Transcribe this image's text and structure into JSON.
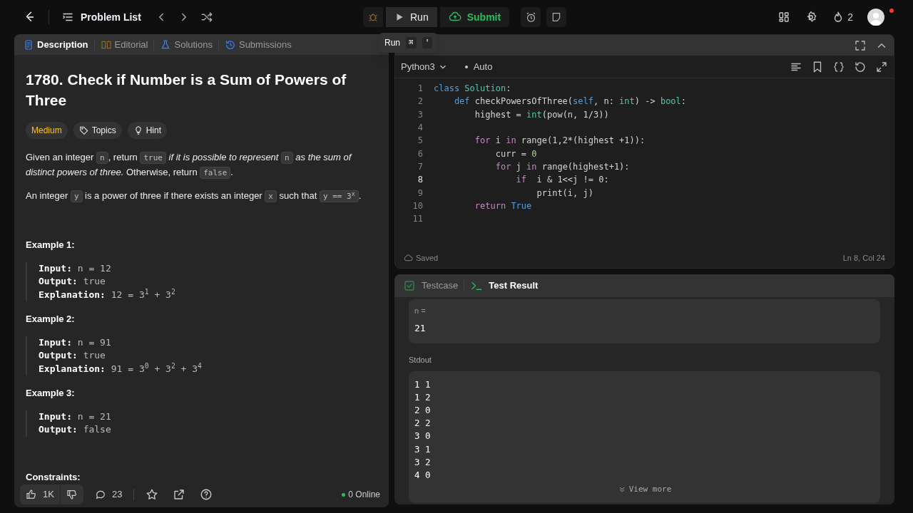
{
  "top_bar": {
    "problem_list": "Problem List",
    "run": "Run",
    "submit": "Submit",
    "streak": "2"
  },
  "tooltip": {
    "label": "Run",
    "keys": [
      "⌘",
      "'"
    ]
  },
  "left_tabs": [
    {
      "label": "Description",
      "selected": true
    },
    {
      "label": "Editorial",
      "selected": false
    },
    {
      "label": "Solutions",
      "selected": false
    },
    {
      "label": "Submissions",
      "selected": false
    }
  ],
  "problem": {
    "title": "1780. Check if Number is a Sum of Powers of Three",
    "difficulty": "Medium",
    "tags": [
      "Topics",
      "Hint"
    ],
    "paragraphs": [
      [
        {
          "kind": "text",
          "text": "Given an integer "
        },
        {
          "kind": "code",
          "text": "n"
        },
        {
          "kind": "text",
          "text": ", return "
        },
        {
          "kind": "code",
          "text": "true"
        },
        {
          "kind": "italic",
          "text": " if it is possible to represent "
        },
        {
          "kind": "code",
          "text": "n"
        },
        {
          "kind": "italic",
          "text": " as the sum of distinct powers of three."
        },
        {
          "kind": "text",
          "text": " Otherwise, return "
        },
        {
          "kind": "code",
          "text": "false"
        },
        {
          "kind": "text",
          "text": "."
        }
      ],
      [
        {
          "kind": "text",
          "text": "An integer "
        },
        {
          "kind": "code",
          "text": "y"
        },
        {
          "kind": "text",
          "text": " is a power of three if there exists an integer "
        },
        {
          "kind": "code",
          "text": "x"
        },
        {
          "kind": "text",
          "text": " such that "
        },
        {
          "kind": "code",
          "text": "y == 3$^{x}$"
        },
        {
          "kind": "text",
          "text": "."
        }
      ]
    ],
    "examples": [
      {
        "title": "Example 1:",
        "lines": [
          {
            "label": "Input:",
            "value": "n = 12"
          },
          {
            "label": "Output:",
            "value": "true"
          },
          {
            "label": "Explanation:",
            "value": "12 = 3$^{1}$ + 3$^{2}$"
          }
        ]
      },
      {
        "title": "Example 2:",
        "lines": [
          {
            "label": "Input:",
            "value": "n = 91"
          },
          {
            "label": "Output:",
            "value": "true"
          },
          {
            "label": "Explanation:",
            "value": "91 = 3$^{0}$ + 3$^{2}$ + 3$^{4}$"
          }
        ]
      },
      {
        "title": "Example 3:",
        "lines": [
          {
            "label": "Input:",
            "value": "n = 21"
          },
          {
            "label": "Output:",
            "value": "false"
          }
        ]
      }
    ],
    "constraints": "Constraints:"
  },
  "footer": {
    "likes": "1K",
    "comments": "23",
    "online": "0 Online"
  },
  "editor": {
    "language": "Python3",
    "mode": "Auto",
    "saved": "Saved",
    "position": "Ln 8, Col 24",
    "lines": [
      {
        "number": "1",
        "active": false,
        "tokens": [
          {
            "kind": "keyword",
            "text": "class"
          },
          {
            "kind": "type",
            "text": " Solution"
          },
          {
            "kind": "plain",
            "text": ":"
          }
        ]
      },
      {
        "number": "2",
        "active": false,
        "tokens": [
          {
            "kind": "keyword",
            "text": "    def"
          },
          {
            "kind": "plain",
            "text": " checkPowersOfThree("
          },
          {
            "kind": "keyword",
            "text": "self"
          },
          {
            "kind": "plain",
            "text": ", n: "
          },
          {
            "kind": "type",
            "text": "int"
          },
          {
            "kind": "plain",
            "text": ") -> "
          },
          {
            "kind": "type",
            "text": "bool"
          },
          {
            "kind": "plain",
            "text": ":"
          }
        ]
      },
      {
        "number": "3",
        "active": false,
        "tokens": [
          {
            "kind": "plain",
            "text": "        highest = "
          },
          {
            "kind": "type",
            "text": "int"
          },
          {
            "kind": "plain",
            "text": "(pow(n, 1/3))"
          }
        ]
      },
      {
        "number": "4",
        "active": false
      },
      {
        "number": "5",
        "active": false,
        "tokens": [
          {
            "kind": "control",
            "text": "        for"
          },
          {
            "kind": "plain",
            "text": " i "
          },
          {
            "kind": "control",
            "text": "in"
          },
          {
            "kind": "plain",
            "text": " range(1,2*(highest +1)):"
          }
        ]
      },
      {
        "number": "6",
        "active": false,
        "tokens": [
          {
            "kind": "plain",
            "text": "            curr = "
          },
          {
            "kind": "number",
            "text": "0"
          }
        ]
      },
      {
        "number": "7",
        "active": false,
        "tokens": [
          {
            "kind": "control",
            "text": "            for"
          },
          {
            "kind": "plain",
            "text": " j "
          },
          {
            "kind": "control",
            "text": "in"
          },
          {
            "kind": "plain",
            "text": " range(highest+1):"
          }
        ]
      },
      {
        "number": "8",
        "active": true,
        "tokens": [
          {
            "kind": "control",
            "text": "                if"
          },
          {
            "kind": "plain",
            "text": "  i & 1<<j != 0:"
          }
        ]
      },
      {
        "number": "9",
        "active": false,
        "tokens": [
          {
            "kind": "plain",
            "text": "                    print(i, j)"
          }
        ]
      },
      {
        "number": "10",
        "active": false,
        "tokens": [
          {
            "kind": "control",
            "text": "        return"
          },
          {
            "kind": "keyword",
            "text": " True"
          }
        ]
      },
      {
        "number": "11",
        "active": false
      }
    ]
  },
  "bottom_tabs": [
    {
      "label": "Testcase",
      "selected": false
    },
    {
      "label": "Test Result",
      "selected": true
    }
  ],
  "result": {
    "input_label": "n =",
    "input_value": "21",
    "stdout_label": "Stdout",
    "stdout": [
      "1 1",
      "1 2",
      "2 0",
      "2 2",
      "3 0",
      "3 1",
      "3 2",
      "4 0"
    ],
    "view_more": "View more"
  }
}
